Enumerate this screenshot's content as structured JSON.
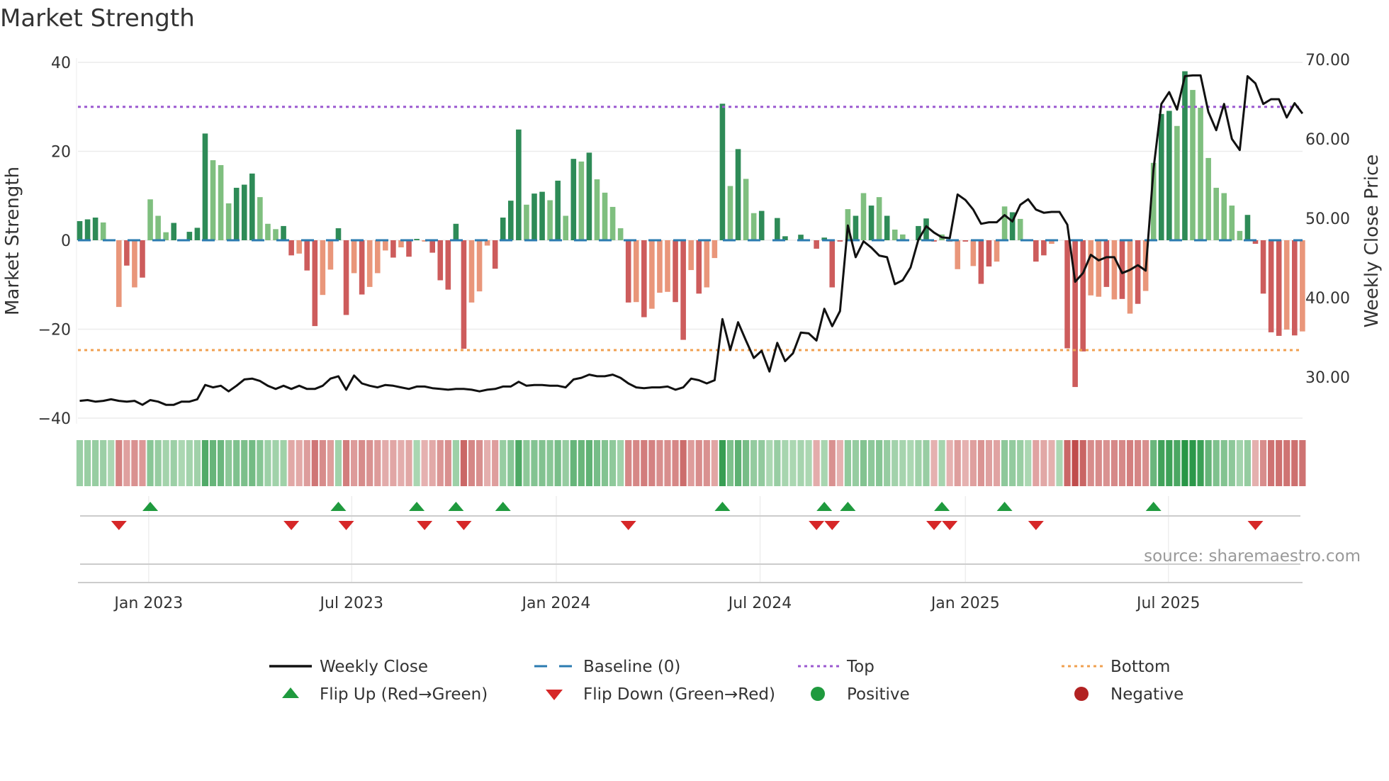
{
  "chart_data": {
    "type": "bar",
    "title": "Market Strength",
    "ylabel": "Market Strength",
    "y2label": "Weekly Close Price",
    "ylim": [
      -42,
      42
    ],
    "y2lim": [
      23.8,
      70.4
    ],
    "yticks": [
      40,
      20,
      0,
      -20,
      -40
    ],
    "yticklabels": [
      "40",
      "20",
      "0",
      "−20",
      "−40"
    ],
    "y2ticks": [
      70,
      60,
      50,
      40,
      30
    ],
    "y2ticklabels": [
      "70.00",
      "60.00",
      "50.00",
      "40.00",
      "30.00"
    ],
    "x_unit": "week index",
    "xticks": [
      {
        "label": "Jan 2023",
        "at": 8.8
      },
      {
        "label": "Jul 2023",
        "at": 34.7
      },
      {
        "label": "Jan 2024",
        "at": 60.8
      },
      {
        "label": "Jul 2024",
        "at": 86.8
      },
      {
        "label": "Jan 2025",
        "at": 113.0
      },
      {
        "label": "Jul 2025",
        "at": 138.9
      }
    ],
    "top_level": 30,
    "bottom_level": -24.7,
    "baseline": 0,
    "strength": [
      4.3,
      4.7,
      5.1,
      4.0,
      0,
      -15,
      -5.7,
      -10.6,
      -8.4,
      9.2,
      5.5,
      1.8,
      3.9,
      0,
      1.9,
      2.8,
      24,
      18,
      16.9,
      8.3,
      11.8,
      12.5,
      15,
      9.7,
      3.7,
      2.5,
      3.2,
      -3.4,
      -3.0,
      -6.8,
      -19.3,
      -12.3,
      -6.6,
      2.7,
      -16.8,
      -7.4,
      -12.2,
      -10.5,
      -7.4,
      -2.3,
      -3.9,
      -1.6,
      -3.7,
      0.3,
      -0.3,
      -2.8,
      -9,
      -11.1,
      3.7,
      -24.4,
      -14,
      -11.5,
      -1.2,
      -6.4,
      5.1,
      8.9,
      24.9,
      8,
      10.5,
      10.9,
      9,
      13.4,
      5.5,
      18.3,
      17.7,
      19.7,
      13.7,
      10.7,
      7.5,
      2.7,
      -14,
      -13.9,
      -17.3,
      -15.4,
      -11.8,
      -11.6,
      -13.9,
      -22.4,
      -6.7,
      -12,
      -10.6,
      -4,
      30.7,
      12.2,
      20.5,
      13.8,
      6.1,
      6.6,
      0,
      5,
      0.9,
      0,
      1.25,
      0,
      -1.9,
      0.6,
      -10.6,
      -0.3,
      7,
      5.5,
      10.6,
      7.8,
      9.7,
      5.5,
      2.4,
      1.3,
      0,
      3.2,
      4.9,
      -0.3,
      1.3,
      -0.3,
      -6.5,
      -0.3,
      -5.8,
      -9.8,
      -5.9,
      -4.8,
      7.6,
      6.3,
      4.8,
      0,
      -4.8,
      -3.4,
      -0.8,
      0,
      -24.3,
      -33,
      -25,
      -12.4,
      -12.7,
      -10.5,
      -13.3,
      -13.2,
      -16.5,
      -14.3,
      -11.4,
      17.4,
      28.4,
      29.1,
      25.7,
      38,
      33.8,
      29.8,
      18.5,
      11.8,
      10.6,
      7.8,
      2.1,
      5.7,
      -0.8,
      -12,
      -20.7,
      -21.5,
      -20.1,
      -21.4,
      -20.5
    ],
    "shade": "dddldldldllldddddlllddd lllddlddllddldllldlddldddddlllddddlddldldldlllldldlllddldlldldllddddlddddddldldldllldddldldlddlldldddlldddlldldldllddldllllllldddddldl",
    "weekly_close": [
      27.0,
      27.1,
      26.9,
      27.0,
      27.2,
      27.0,
      26.9,
      27.0,
      26.5,
      27.1,
      26.9,
      26.5,
      26.5,
      26.9,
      26.9,
      27.2,
      29.0,
      28.7,
      28.9,
      28.2,
      28.9,
      29.7,
      29.8,
      29.5,
      28.9,
      28.5,
      28.9,
      28.5,
      28.9,
      28.5,
      28.5,
      28.9,
      29.8,
      30.1,
      28.4,
      30.2,
      29.2,
      28.9,
      28.7,
      29.0,
      28.9,
      28.7,
      28.5,
      28.8,
      28.8,
      28.6,
      28.5,
      28.4,
      28.5,
      28.5,
      28.4,
      28.2,
      28.4,
      28.5,
      28.8,
      28.8,
      29.4,
      28.9,
      29.0,
      29.0,
      28.9,
      28.9,
      28.7,
      29.7,
      29.9,
      30.3,
      30.1,
      30.1,
      30.3,
      29.9,
      29.2,
      28.7,
      28.6,
      28.7,
      28.7,
      28.8,
      28.4,
      28.7,
      29.8,
      29.6,
      29.2,
      29.6,
      37.3,
      33.4,
      36.9,
      34.6,
      32.4,
      33.3,
      30.7,
      34.3,
      32.0,
      33.0,
      35.6,
      35.5,
      34.6,
      38.6,
      36.4,
      38.3,
      49.1,
      45.1,
      47.1,
      46.3,
      45.3,
      45.1,
      41.7,
      42.2,
      43.8,
      47.3,
      49.0,
      48.2,
      47.6,
      47.5,
      53.0,
      52.3,
      51.1,
      49.3,
      49.5,
      49.5,
      50.4,
      49.6,
      51.7,
      52.4,
      51.1,
      50.7,
      50.8,
      50.8,
      49.2,
      42.0,
      43.1,
      45.4,
      44.7,
      45.1,
      45.1,
      43.1,
      43.5,
      44.1,
      43.4,
      56.2,
      64.4,
      65.9,
      63.7,
      67.9,
      68.0,
      68.0,
      63.4,
      61.1,
      64.4,
      60.0,
      58.6,
      67.9,
      67.0,
      64.4,
      65.0,
      65.0,
      62.7,
      64.5,
      63.2
    ],
    "flip_up": [
      9,
      33,
      43,
      48,
      54,
      82,
      95,
      98,
      110,
      118,
      137
    ],
    "flip_down": [
      5,
      27,
      34,
      44,
      49,
      70,
      94,
      96,
      109,
      111,
      122,
      150
    ],
    "legend": [
      {
        "label": "Weekly Close",
        "kind": "line",
        "color": "#111111"
      },
      {
        "label": "Baseline (0)",
        "kind": "dash",
        "color": "#2b7bb0"
      },
      {
        "label": "Top",
        "kind": "dot",
        "color": "#9b59d0"
      },
      {
        "label": "Bottom",
        "kind": "dot",
        "color": "#f0a050"
      },
      {
        "label": "Flip Up (Red→Green)",
        "kind": "up",
        "color": "#1f9a3e"
      },
      {
        "label": "Flip Down (Green→Red)",
        "kind": "down",
        "color": "#d62728"
      },
      {
        "label": "Positive",
        "kind": "dot-marker",
        "color": "#1f9a3e"
      },
      {
        "label": "Negative",
        "kind": "dot-marker",
        "color": "#b22222"
      }
    ],
    "legend_placement": "bottom",
    "grid": true,
    "source": "source: sharemaestro.com",
    "colors": {
      "pos_dark": "#2e8b57",
      "pos_light": "#7fbf7f",
      "neg_dark": "#cd5c5c",
      "neg_light": "#e9967a"
    }
  }
}
